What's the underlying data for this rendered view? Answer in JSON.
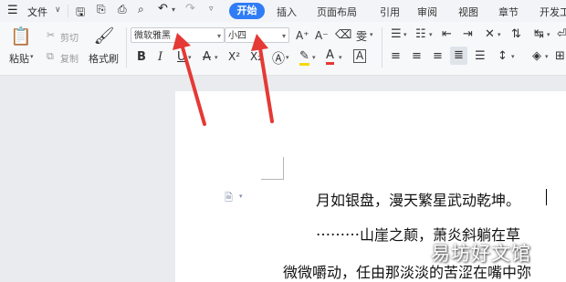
{
  "menubar": {
    "menu_label": "文件",
    "tabs": [
      "开始",
      "插入",
      "页面布局",
      "引用",
      "审阅",
      "视图",
      "章节",
      "开发工"
    ]
  },
  "ribbon": {
    "paste_label": "粘贴",
    "cut_label": "剪切",
    "copy_label": "复制",
    "format_painter_label": "格式刷",
    "font_name": "微软雅黑",
    "font_size": "小四",
    "bold": "B",
    "italic": "I",
    "underline": "U",
    "superscript": "X²",
    "subscript": "X₂",
    "font_color_letter": "A"
  },
  "document": {
    "lines": [
      "月如银盘，漫天繁星武动乾坤。",
      "⋯⋯⋯山崖之颠，萧炎斜躺在草",
      "微微嚼动，任由那淡淡的苦涩在嘴中弥"
    ]
  },
  "watermark": "易坊好文馆",
  "colors": {
    "accent": "#2f7cf6",
    "annotation_arrow": "#e53935"
  }
}
